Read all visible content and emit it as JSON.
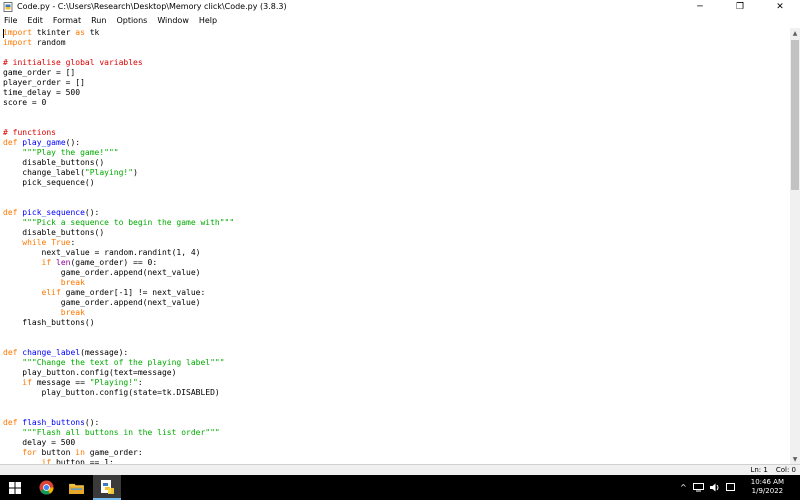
{
  "window": {
    "title": "Code.py - C:\\Users\\Research\\Desktop\\Memory click\\Code.py (3.8.3)",
    "controls": {
      "minimize": "─",
      "maximize": "❐",
      "close": "✕"
    }
  },
  "menubar": {
    "items": [
      "File",
      "Edit",
      "Format",
      "Run",
      "Options",
      "Window",
      "Help"
    ]
  },
  "editor": {
    "lines": [
      [
        [
          "import",
          "kw"
        ],
        [
          " tkinter ",
          ""
        ],
        [
          "as",
          "kw"
        ],
        [
          " tk",
          ""
        ]
      ],
      [
        [
          "import",
          "kw"
        ],
        [
          " random",
          ""
        ]
      ],
      [],
      [
        [
          "# initialise global variables",
          "cm"
        ]
      ],
      [
        [
          "game_order = []",
          ""
        ]
      ],
      [
        [
          "player_order = []",
          ""
        ]
      ],
      [
        [
          "time_delay = 500",
          ""
        ]
      ],
      [
        [
          "score = 0",
          ""
        ]
      ],
      [],
      [],
      [
        [
          "# functions",
          "cm"
        ]
      ],
      [
        [
          "def",
          "kw"
        ],
        [
          " ",
          ""
        ],
        [
          "play_game",
          "def"
        ],
        [
          "():",
          ""
        ]
      ],
      [
        [
          "    ",
          ""
        ],
        [
          "\"\"\"Play the game!\"\"\"",
          "str"
        ]
      ],
      [
        [
          "    disable_buttons()",
          ""
        ]
      ],
      [
        [
          "    change_label(",
          ""
        ],
        [
          "\"Playing!\"",
          "str"
        ],
        [
          ")",
          ""
        ]
      ],
      [
        [
          "    pick_sequence()",
          ""
        ]
      ],
      [],
      [],
      [
        [
          "def",
          "kw"
        ],
        [
          " ",
          ""
        ],
        [
          "pick_sequence",
          "def"
        ],
        [
          "():",
          ""
        ]
      ],
      [
        [
          "    ",
          ""
        ],
        [
          "\"\"\"Pick a sequence to begin the game with\"\"\"",
          "str"
        ]
      ],
      [
        [
          "    disable_buttons()",
          ""
        ]
      ],
      [
        [
          "    ",
          ""
        ],
        [
          "while",
          "kw"
        ],
        [
          " ",
          ""
        ],
        [
          "True",
          "kw"
        ],
        [
          ":",
          ""
        ]
      ],
      [
        [
          "        next_value = random.randint(1, 4)",
          ""
        ]
      ],
      [
        [
          "        ",
          ""
        ],
        [
          "if",
          "kw"
        ],
        [
          " ",
          ""
        ],
        [
          "len",
          "bi"
        ],
        [
          "(game_order) == 0:",
          ""
        ]
      ],
      [
        [
          "            game_order.append(next_value)",
          ""
        ]
      ],
      [
        [
          "            ",
          ""
        ],
        [
          "break",
          "kw"
        ]
      ],
      [
        [
          "        ",
          ""
        ],
        [
          "elif",
          "kw"
        ],
        [
          " game_order[-1] != next_value:",
          ""
        ]
      ],
      [
        [
          "            game_order.append(next_value)",
          ""
        ]
      ],
      [
        [
          "            ",
          ""
        ],
        [
          "break",
          "kw"
        ]
      ],
      [
        [
          "    flash_buttons()",
          ""
        ]
      ],
      [],
      [],
      [
        [
          "def",
          "kw"
        ],
        [
          " ",
          ""
        ],
        [
          "change_label",
          "def"
        ],
        [
          "(message):",
          ""
        ]
      ],
      [
        [
          "    ",
          ""
        ],
        [
          "\"\"\"Change the text of the playing label\"\"\"",
          "str"
        ]
      ],
      [
        [
          "    play_button.config(text=message)",
          ""
        ]
      ],
      [
        [
          "    ",
          ""
        ],
        [
          "if",
          "kw"
        ],
        [
          " message == ",
          ""
        ],
        [
          "\"Playing!\"",
          "str"
        ],
        [
          ":",
          ""
        ]
      ],
      [
        [
          "        play_button.config(state=tk.DISABLED)",
          ""
        ]
      ],
      [],
      [],
      [
        [
          "def",
          "kw"
        ],
        [
          " ",
          ""
        ],
        [
          "flash_buttons",
          "def"
        ],
        [
          "():",
          ""
        ]
      ],
      [
        [
          "    ",
          ""
        ],
        [
          "\"\"\"Flash all buttons in the list order\"\"\"",
          "str"
        ]
      ],
      [
        [
          "    delay = 500",
          ""
        ]
      ],
      [
        [
          "    ",
          ""
        ],
        [
          "for",
          "kw"
        ],
        [
          " button ",
          ""
        ],
        [
          "in",
          "kw"
        ],
        [
          " game_order:",
          ""
        ]
      ],
      [
        [
          "        ",
          ""
        ],
        [
          "if",
          "kw"
        ],
        [
          " button == 1:",
          ""
        ]
      ]
    ]
  },
  "status": {
    "line": "Ln: 1",
    "col": "Col: 0"
  },
  "taskbar": {
    "icons": [
      "windows-start-icon",
      "chrome-browser-icon",
      "file-explorer-icon",
      "python-idle-icon"
    ],
    "tray": {
      "chevron": "^",
      "language": ""
    },
    "clock": {
      "time": "10:46 AM",
      "date": "1/9/2022"
    }
  },
  "colors": {
    "keyword": "#ff7700",
    "builtin": "#900090",
    "string": "#00aa00",
    "comment": "#dd0000",
    "definition": "#0000ff",
    "taskbar": "#000000"
  }
}
